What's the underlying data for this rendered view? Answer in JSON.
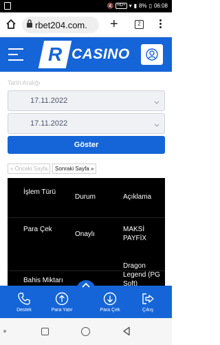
{
  "status_bar": {
    "time": "06:08",
    "battery": "8%",
    "hd_badge": "HD+"
  },
  "browser": {
    "url": "rbet204.com.",
    "tab_count": "2"
  },
  "site": {
    "logo_mark": "R",
    "logo_text": "CASINO"
  },
  "form": {
    "date_range_label": "Tarih Aralığı",
    "start_date": "17.11.2022",
    "end_date": "17.11.2022",
    "show_button": "Göster",
    "prev_page": "« Önceki Sayfa",
    "next_page": "Sonraki Sayfa »"
  },
  "table": {
    "headers": [
      "İşlem Türü",
      "Durum",
      "Açıklama"
    ],
    "rows": [
      [
        "Para Çek",
        "Onaylı",
        "MAKSİ PAYFİX"
      ],
      [
        "Bahis Miktarı",
        "",
        "Dragon Legend (PG Soft)"
      ]
    ]
  },
  "bottom_nav": {
    "items": [
      {
        "label": "Destek",
        "icon": "phone-icon"
      },
      {
        "label": "Para Yatır",
        "icon": "arrow-up-circle-icon"
      },
      {
        "label": "Para Çek",
        "icon": "arrow-down-circle-icon"
      },
      {
        "label": "Çıkış",
        "icon": "logout-icon"
      }
    ]
  },
  "colors": {
    "brand": "#1565d8",
    "table_bg": "#000000"
  }
}
